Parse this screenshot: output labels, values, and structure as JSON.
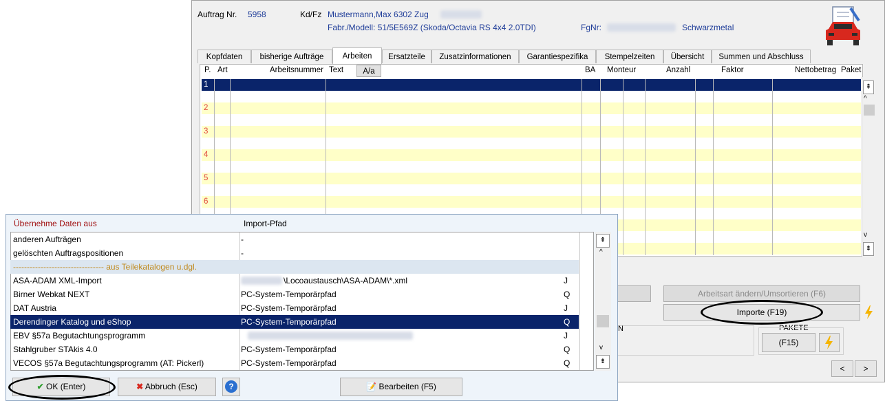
{
  "header": {
    "order_label": "Auftrag Nr.",
    "order_value": "5958",
    "customer_label": "Kd/Fz",
    "customer_value": "Mustermann,Max 6302 Zug",
    "model_value": "Fabr./Modell: 51/5E569Z (Skoda/Octavia RS 4x4 2.0TDI)",
    "fgnr_label": "FgNr:",
    "color_value": "Schwarzmetal"
  },
  "tabs": [
    {
      "label": "Kopfdaten"
    },
    {
      "label": "bisherige Aufträge"
    },
    {
      "label": "Arbeiten"
    },
    {
      "label": "Ersatzteile"
    },
    {
      "label": "Zusatzinformationen"
    },
    {
      "label": "Garantiespezifika"
    },
    {
      "label": "Stempelzeiten"
    },
    {
      "label": "Übersicht"
    },
    {
      "label": "Summen und Abschluss"
    }
  ],
  "grid": {
    "columns": [
      "P.",
      "Art",
      "Arbeitsnummer",
      "Text",
      "A/a",
      "BA",
      "Monteur",
      "Anzahl",
      "Faktor",
      "Nettobetrag",
      "Paket"
    ],
    "row_numbers": [
      "1",
      "2",
      "3",
      "4",
      "5",
      "6"
    ]
  },
  "buttons": {
    "change_worktype": "Arbeitsart ändern/Umsortieren (F6)",
    "imports": "Importe (F19)",
    "packages_label": "PAKETE",
    "packages_btn": "(F15)",
    "n_label": "N",
    "prev": "<",
    "next": ">"
  },
  "dialog": {
    "col1_header": "Übernehme Daten aus",
    "col2_header": "Import-Pfad",
    "rows": [
      {
        "source": "anderen Aufträgen",
        "path": "-",
        "flag": ""
      },
      {
        "source": "gelöschten Auftragspositionen",
        "path": "-",
        "flag": ""
      },
      {
        "source": "--------------------------------- aus Teilekatalogen u.dgl.",
        "path": "",
        "flag": ""
      },
      {
        "source": "ASA-ADAM XML-Import",
        "path": "\\Locoaustausch\\ASA-ADAM\\*.xml",
        "flag": "J"
      },
      {
        "source": "Birner Webkat NEXT",
        "path": "PC-System-Temporärpfad",
        "flag": "Q"
      },
      {
        "source": "DAT Austria",
        "path": "PC-System-Temporärpfad",
        "flag": "J"
      },
      {
        "source": "Derendinger Katalog und eShop",
        "path": "PC-System-Temporärpfad",
        "flag": "Q"
      },
      {
        "source": "EBV §57a Begutachtungsprogramm",
        "path": "",
        "flag": "J"
      },
      {
        "source": "Stahlgruber STAkis 4.0",
        "path": "PC-System-Temporärpfad",
        "flag": "Q"
      },
      {
        "source": "VECOS §57a Begutachtungsprogramm (AT: Pickerl)",
        "path": "PC-System-Temporärpfad",
        "flag": "Q"
      }
    ],
    "ok": "OK (Enter)",
    "cancel": "Abbruch (Esc)",
    "help": "?",
    "edit": "Bearbeiten (F5)"
  },
  "colors": {
    "selection": "#0a246a",
    "row_yellow": "#ffffc8",
    "row_number": "#e0463c",
    "header_value": "#1f3d99",
    "dialog_header_red": "#a01010",
    "catalog_separator": "#c08a1e",
    "lightning": "#f5b400"
  }
}
